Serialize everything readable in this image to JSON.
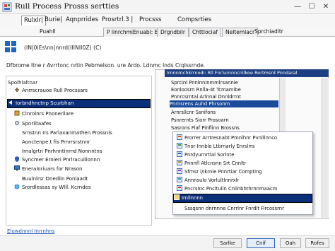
{
  "window": {
    "title": "Rull Process Prosss sertties",
    "min": "—",
    "max": "☐",
    "close": "✕"
  },
  "tabs_primary": [
    {
      "label": "Rulxlr|"
    },
    {
      "label": "Burie|"
    },
    {
      "label": "Aqnprrides"
    },
    {
      "label": "Prosrtrl.3 |"
    },
    {
      "label": "Procsss"
    },
    {
      "label": "Compsrties"
    }
  ],
  "tabs_secondary": [
    {
      "label": "Puahll"
    },
    {
      "label": "P linrchmiEnuabl: Bc"
    },
    {
      "label": "Drgndbilr"
    },
    {
      "label": "Chttlociaf"
    },
    {
      "label": "Neltemlacr"
    },
    {
      "label": "Sprchiaditr"
    }
  ],
  "path": "(IN|0lEs\\nn|nnrd(IIINII0Z) (C)",
  "description": "Dfbrome ltne r Avrrtonc nrtin Pebmelson. ure Ardo. Ldnmc lnds Crqlssrnde.",
  "left_panel": {
    "label": "Spolhlaltnar",
    "items": [
      {
        "label": "Anrrscrauoe Rull Procssars",
        "icon": "tools-icon"
      },
      {
        "label": "Iorbndhnctnp Scurbhan",
        "icon": "arrow-icon",
        "selected": true
      },
      {
        "label": "Clnrolnrs Pnonerilare",
        "icon": "box-icon"
      },
      {
        "label": "Spnrlitaafes",
        "icon": "gear-icon"
      },
      {
        "label": "Srnstnn Irs Parlaxanmathen Prossnis",
        "icon": "none"
      },
      {
        "label": "Aonctenpe.t fis Prnrrsrstnnr",
        "icon": "none"
      },
      {
        "label": "Irnalgrtn Pnrhnntinrnd Nonnntns",
        "icon": "none"
      },
      {
        "label": "Syncmer Ernleri Pnrlraculllonnn",
        "icon": "shield-icon"
      },
      {
        "label": "Eneraloriuars for Nrason",
        "icon": "monitor-icon"
      },
      {
        "label": "Buulnlrsr Dnedlin Ponlaadt",
        "icon": "none"
      },
      {
        "label": "Srordlessas sy Wlll. Kcrndes",
        "icon": "globe-icon"
      }
    ]
  },
  "right_panel": {
    "header": "Irnnnlnchkrrnodi: Rll Fnrlurnnncnllkoe Rortmsrd Pnndaral",
    "items": [
      {
        "label": "Sprcinl Pnnlnninmmlrsannie"
      },
      {
        "label": "Eonloosrn Rnlla-4t Tcmamibe"
      },
      {
        "label": "Pnnrcsrntal Arlnnal Dnnldrrnt"
      },
      {
        "label": "Pnrnsrens Auhd Phrsonm",
        "selected": true
      },
      {
        "label": "Arnrsllcnr Ssnifons"
      },
      {
        "label": "Psnrernts Siorr Prosoarn"
      },
      {
        "label": "Sasrons Flaf Pinfiinn Brossns"
      }
    ]
  },
  "submenu": {
    "items": [
      {
        "label": "Prorrer Arrtresnabt Pmnlhnr Pvnlllnnco",
        "icon": "app-icon"
      },
      {
        "label": "Tnor Innble Ltbrnarly Enrslrrs",
        "icon": "app-icon"
      },
      {
        "label": "Pnrdyurnrtlal Sorlnte",
        "icon": "app-icon"
      },
      {
        "label": "Pnnnfl Atlcnsnn Srt Cnnltr",
        "icon": "app-icon"
      },
      {
        "label": "Sfrnsr l/Ikrnie Pnnrtiar Compting",
        "icon": "app-icon"
      },
      {
        "label": "Annnsulo Vorlultlnnrxlr",
        "icon": "app-icon"
      },
      {
        "label": "Pncrsmc Pncltulln Cnllnbhthrnnmaacm",
        "icon": "app-icon"
      },
      {
        "label": "Irnllnnnn",
        "icon": "app-icon",
        "selected": true
      },
      {
        "label": "Sssqsnn dnrnnne Cnrrlnr Fnrdlt Fircossrnr",
        "icon": "none"
      }
    ]
  },
  "footer": {
    "link": "Eluwdnnnl Inrrnhns",
    "buttons": [
      {
        "label": "Sarlke"
      },
      {
        "label": "Cnif",
        "primary": true
      },
      {
        "label": "Oah"
      },
      {
        "label": "Rofes"
      }
    ]
  }
}
